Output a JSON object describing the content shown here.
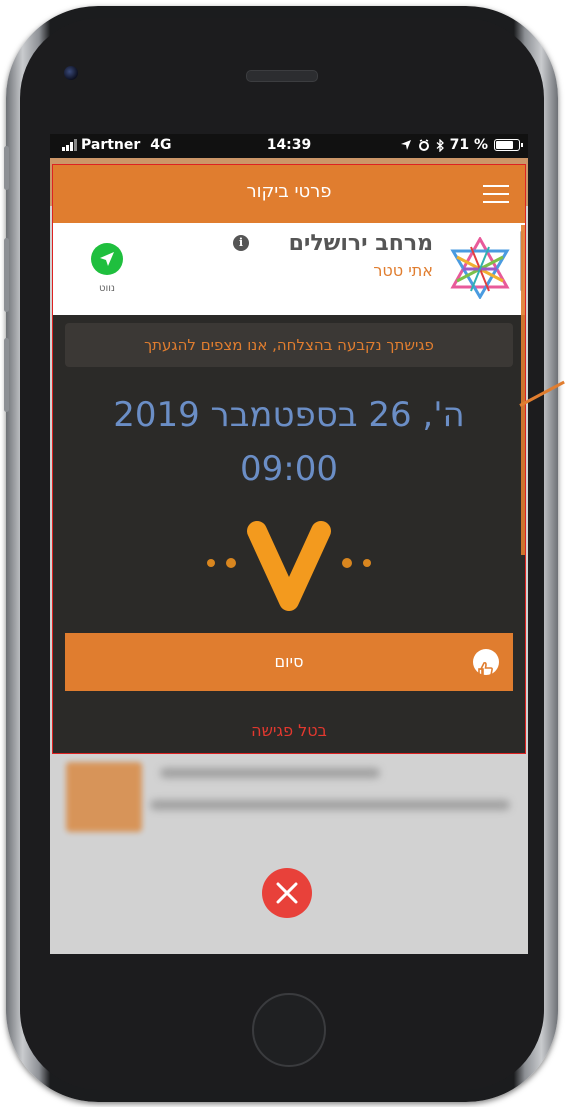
{
  "status_bar": {
    "carrier": "Partner",
    "network": "4G",
    "time": "14:39",
    "battery": "71 %"
  },
  "modal": {
    "title": "פרטי ביקור",
    "org_name": "מרחב ירושלים",
    "org_contact": "אתי טטר",
    "info_glyph": "i",
    "nav_label": "נווט",
    "success_message": "פגישתך נקבעה בהצלחה, אנו מצפים להגעתך",
    "date": "ה', 26 בספטמבר 2019",
    "time": "09:00",
    "finish_label": "סיום",
    "cancel_label": "בטל פגישה"
  },
  "icons": {
    "menu": "hamburger-menu-icon",
    "info": "info-icon",
    "navigate": "navigate-arrow-icon",
    "thumb": "thumbs-up-icon",
    "close": "close-x-icon",
    "success": "checkmark-v-icon"
  },
  "colors": {
    "accent": "#e07d2f",
    "date_text": "#6b8ec6",
    "cancel": "#e2382f",
    "nav_green": "#1fbf3e",
    "close_red": "#e8413a"
  }
}
